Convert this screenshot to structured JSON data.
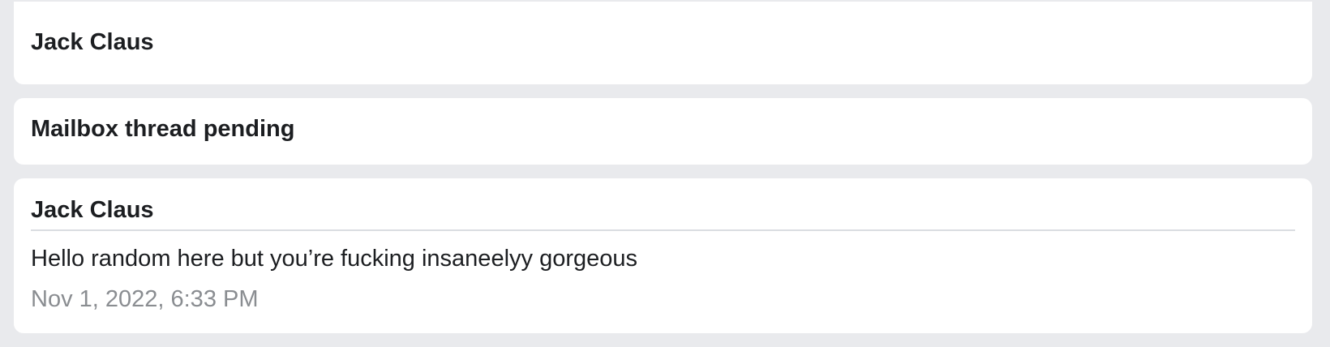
{
  "header_card": {
    "name": "Jack Claus"
  },
  "status_card": {
    "text": "Mailbox thread pending"
  },
  "message_card": {
    "sender": "Jack Claus",
    "body": "Hello random here but you’re fucking insaneelyy gorgeous",
    "timestamp": "Nov 1, 2022, 6:33 PM"
  },
  "colors": {
    "page_background": "#e9eaed",
    "card_background": "#ffffff",
    "text_primary": "#1c1e21",
    "text_secondary": "#8a8d91",
    "divider": "#dadde1"
  }
}
